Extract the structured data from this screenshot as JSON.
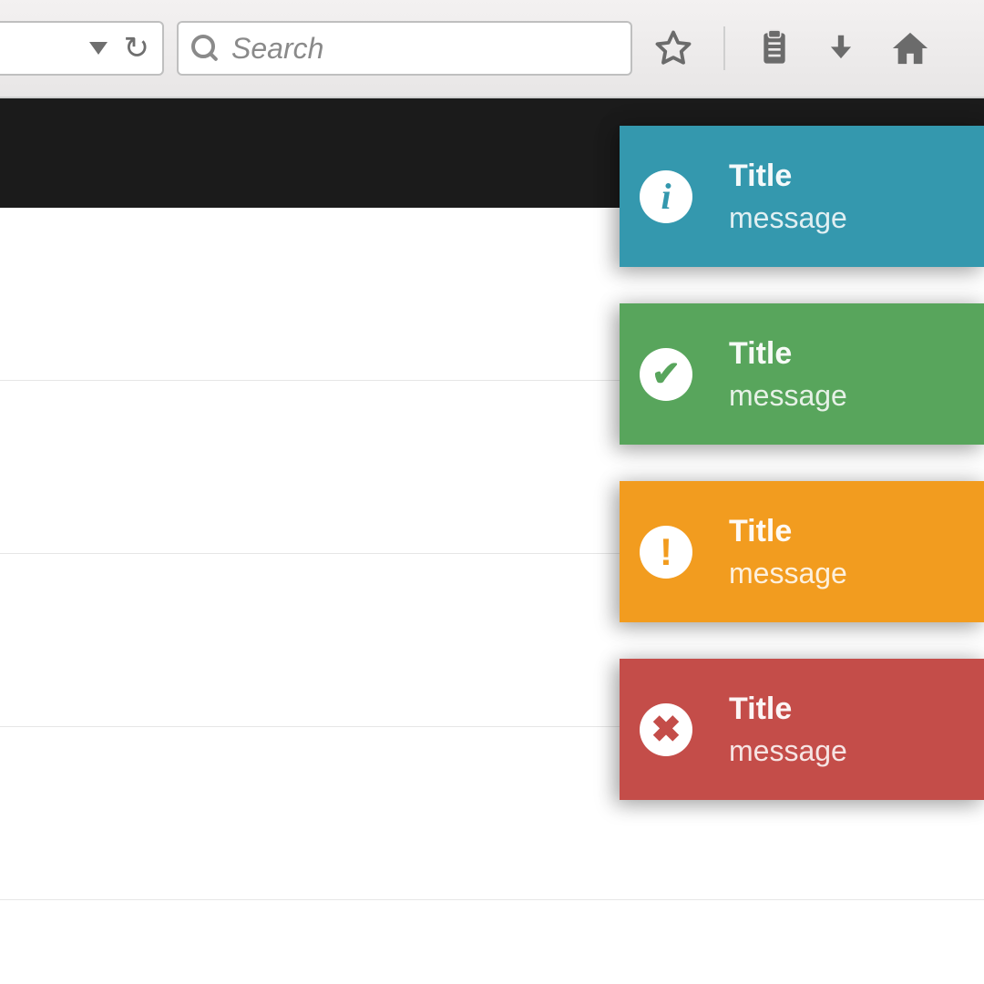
{
  "toolbar": {
    "search_placeholder": "Search"
  },
  "toasts": [
    {
      "kind": "info",
      "title": "Title",
      "message": "message"
    },
    {
      "kind": "success",
      "title": "Title",
      "message": "message"
    },
    {
      "kind": "warning",
      "title": "Title",
      "message": "message"
    },
    {
      "kind": "error",
      "title": "Title",
      "message": "message"
    }
  ],
  "colors": {
    "info": "#3498ae",
    "success": "#58a55c",
    "warning": "#f29c1f",
    "error": "#c44d49"
  }
}
